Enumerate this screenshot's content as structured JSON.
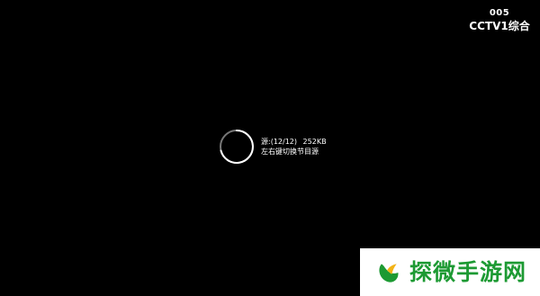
{
  "channel": {
    "number": "005",
    "name": "CCTV1综合"
  },
  "loading": {
    "source": "源:(12/12)",
    "speed": "252KB",
    "hint": "左右键切换节目源"
  },
  "watermark": {
    "text": "探微手游网",
    "color": "#1d9a33"
  },
  "icons": {
    "spinner": "loading-spinner-icon",
    "logo": "leaf-logo-icon"
  }
}
